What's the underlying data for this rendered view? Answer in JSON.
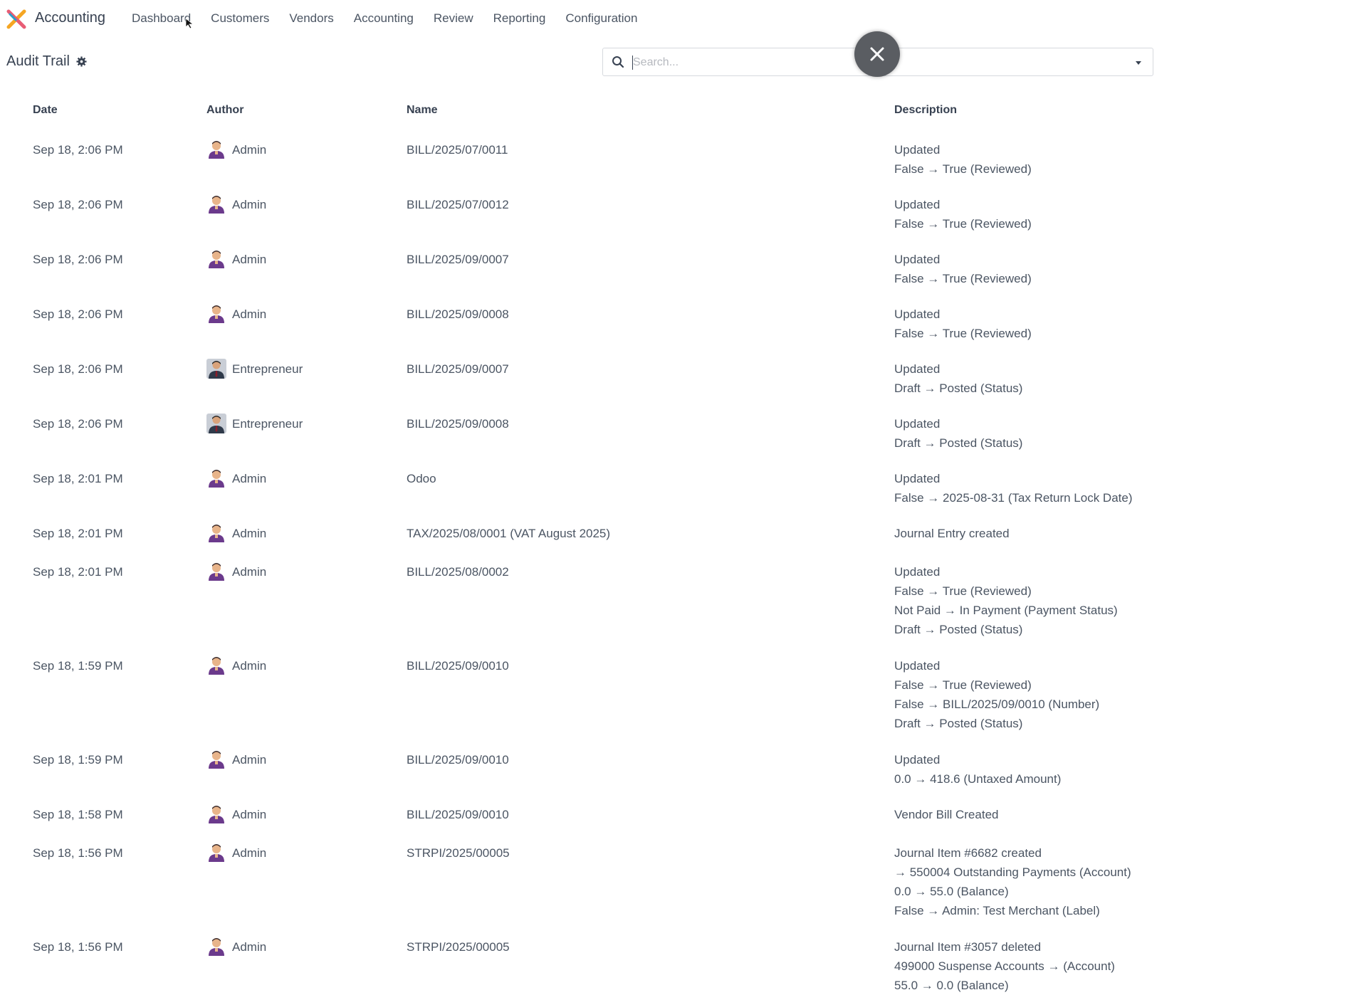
{
  "app": {
    "name": "Accounting",
    "menu": [
      "Dashboard",
      "Customers",
      "Vendors",
      "Accounting",
      "Review",
      "Reporting",
      "Configuration"
    ]
  },
  "control_panel": {
    "title": "Audit Trail",
    "search_placeholder": "Search..."
  },
  "table": {
    "headers": {
      "date": "Date",
      "author": "Author",
      "name": "Name",
      "description": "Description"
    },
    "rows": [
      {
        "date": "Sep 18, 2:06 PM",
        "author": "Admin",
        "avatar": "admin",
        "name": "BILL/2025/07/0011",
        "description": [
          "Updated",
          "False → True (Reviewed)"
        ]
      },
      {
        "date": "Sep 18, 2:06 PM",
        "author": "Admin",
        "avatar": "admin",
        "name": "BILL/2025/07/0012",
        "description": [
          "Updated",
          "False → True (Reviewed)"
        ]
      },
      {
        "date": "Sep 18, 2:06 PM",
        "author": "Admin",
        "avatar": "admin",
        "name": "BILL/2025/09/0007",
        "description": [
          "Updated",
          "False → True (Reviewed)"
        ]
      },
      {
        "date": "Sep 18, 2:06 PM",
        "author": "Admin",
        "avatar": "admin",
        "name": "BILL/2025/09/0008",
        "description": [
          "Updated",
          "False → True (Reviewed)"
        ]
      },
      {
        "date": "Sep 18, 2:06 PM",
        "author": "Entrepreneur",
        "avatar": "entrepreneur",
        "name": "BILL/2025/09/0007",
        "description": [
          "Updated",
          "Draft → Posted (Status)"
        ]
      },
      {
        "date": "Sep 18, 2:06 PM",
        "author": "Entrepreneur",
        "avatar": "entrepreneur",
        "name": "BILL/2025/09/0008",
        "description": [
          "Updated",
          "Draft → Posted (Status)"
        ]
      },
      {
        "date": "Sep 18, 2:01 PM",
        "author": "Admin",
        "avatar": "admin",
        "name": "Odoo",
        "description": [
          "Updated",
          "False → 2025-08-31 (Tax Return Lock Date)"
        ]
      },
      {
        "date": "Sep 18, 2:01 PM",
        "author": "Admin",
        "avatar": "admin",
        "name": "TAX/2025/08/0001 (VAT August 2025)",
        "description": [
          "Journal Entry created"
        ]
      },
      {
        "date": "Sep 18, 2:01 PM",
        "author": "Admin",
        "avatar": "admin",
        "name": "BILL/2025/08/0002",
        "description": [
          "Updated",
          "False → True (Reviewed)",
          "Not Paid → In Payment (Payment Status)",
          "Draft → Posted (Status)"
        ]
      },
      {
        "date": "Sep 18, 1:59 PM",
        "author": "Admin",
        "avatar": "admin",
        "name": "BILL/2025/09/0010",
        "description": [
          "Updated",
          "False → True (Reviewed)",
          "False → BILL/2025/09/0010 (Number)",
          "Draft → Posted (Status)"
        ]
      },
      {
        "date": "Sep 18, 1:59 PM",
        "author": "Admin",
        "avatar": "admin",
        "name": "BILL/2025/09/0010",
        "description": [
          "Updated",
          "0.0 → 418.6 (Untaxed Amount)"
        ]
      },
      {
        "date": "Sep 18, 1:58 PM",
        "author": "Admin",
        "avatar": "admin",
        "name": "BILL/2025/09/0010",
        "description": [
          "Vendor Bill Created"
        ]
      },
      {
        "date": "Sep 18, 1:56 PM",
        "author": "Admin",
        "avatar": "admin",
        "name": "STRPI/2025/00005",
        "description": [
          "Journal Item #6682 created",
          "→ 550004 Outstanding Payments (Account)",
          "0.0 → 55.0 (Balance)",
          "False → Admin: Test Merchant (Label)"
        ]
      },
      {
        "date": "Sep 18, 1:56 PM",
        "author": "Admin",
        "avatar": "admin",
        "name": "STRPI/2025/00005",
        "description": [
          "Journal Item #3057 deleted",
          "499000 Suspense Accounts → (Account)",
          "55.0 → 0.0 (Balance)"
        ]
      }
    ]
  },
  "colors": {
    "accent": "#714b67",
    "text": "#4b5563",
    "close_button": "#5a5d62"
  }
}
